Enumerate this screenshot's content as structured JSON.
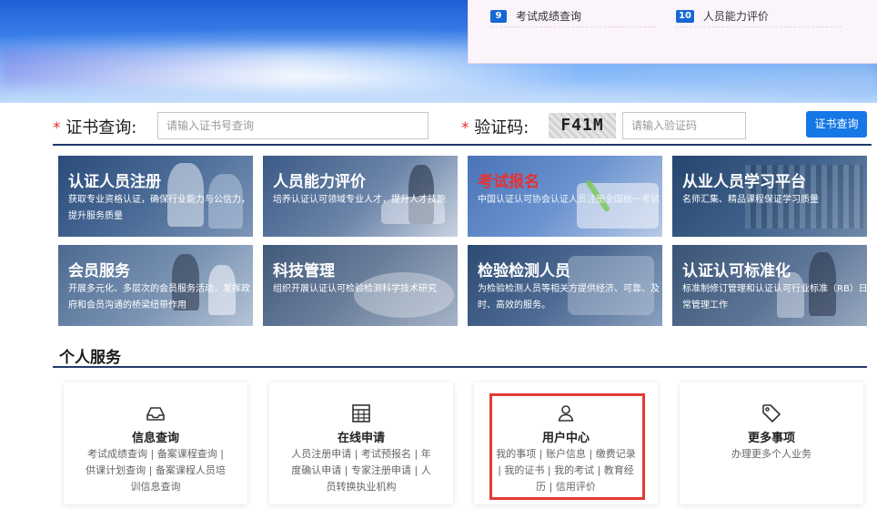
{
  "banner_panel": {
    "items": [
      {
        "num": "9",
        "text": "考试成绩查询"
      },
      {
        "num": "10",
        "text": "人员能力评价"
      }
    ]
  },
  "search": {
    "required_mark": "*",
    "cert_label": "证书查询:",
    "cert_placeholder": "请输入证书号查询",
    "captcha_label": "验证码:",
    "captcha_text": "F41M",
    "captcha_placeholder": "请输入验证码",
    "query_button": "证书查询"
  },
  "tiles": [
    {
      "title": "认证人员注册",
      "desc": "获取专业资格认证，确保行业能力与公信力，提升服务质量",
      "title_color": "#ffffff"
    },
    {
      "title": "人员能力评价",
      "desc": "培养认证认可领域专业人才，提升人才技能",
      "title_color": "#ffffff"
    },
    {
      "title": "考试报名",
      "desc": "中国认证认可协会认证人员注册全国统一考试",
      "title_color": "#e83131"
    },
    {
      "title": "从业人员学习平台",
      "desc": "名师汇集、精品课程保证学习质量",
      "title_color": "#ffffff"
    },
    {
      "title": "会员服务",
      "desc": "开展多元化、多层次的会员服务活动，发挥政府和会员沟通的桥梁纽带作用",
      "title_color": "#ffffff"
    },
    {
      "title": "科技管理",
      "desc": "组织开展认证认可检验检测科学技术研究",
      "title_color": "#ffffff"
    },
    {
      "title": "检验检测人员",
      "desc": "为检验检测人员等相关方提供经济、可靠、及时、高效的服务。",
      "title_color": "#ffffff"
    },
    {
      "title": "认证认可标准化",
      "desc": "标准制修订管理和认证认可行业标准（RB）日常管理工作",
      "title_color": "#ffffff"
    }
  ],
  "personal_services": {
    "title": "个人服务",
    "cards": [
      {
        "icon": "inbox-icon",
        "title": "信息查询",
        "desc": "考试成绩查询 | 备案课程查询 | 供课计划查询 | 备案课程人员培训信息查询"
      },
      {
        "icon": "grid-icon",
        "title": "在线申请",
        "desc": "人员注册申请 | 考试预报名 | 年度确认申请 | 专家注册申请 | 人员转换执业机构"
      },
      {
        "icon": "user-icon",
        "title": "用户中心",
        "desc": "我的事项 | 账户信息 | 缴费记录 | 我的证书 | 我的考试 | 教育经历 | 信用评价"
      },
      {
        "icon": "tag-icon",
        "title": "更多事项",
        "desc": "办理更多个人业务"
      }
    ]
  },
  "colors": {
    "accent_blue": "#1677e6",
    "navy_rule": "#1f3a6b",
    "highlight_red": "#e53935"
  }
}
